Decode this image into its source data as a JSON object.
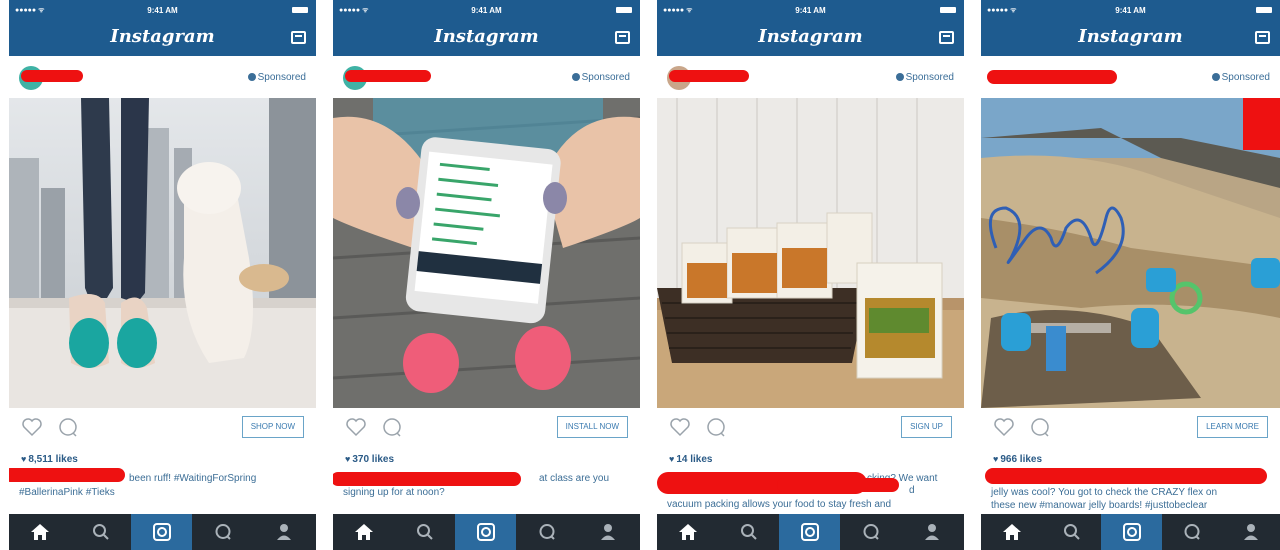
{
  "status_bar": {
    "signal": "●●●●● ᯤ",
    "time": "9:41 AM"
  },
  "app": {
    "title": "Instagram"
  },
  "posts": [
    {
      "sponsored": "Sponsored",
      "cta": "SHOP NOW",
      "likes": "8,511 likes",
      "caption": [
        "been ruff! #WaitingForSpring",
        "#BallerinaPink #Tieks"
      ]
    },
    {
      "sponsored": "Sponsored",
      "cta": "INSTALL NOW",
      "likes": "370 likes",
      "caption": [
        "at class are you",
        "signing up for at noon?"
      ]
    },
    {
      "sponsored": "Sponsored",
      "cta": "SIGN UP",
      "likes": "14 likes",
      "caption": [
        "cking? We want",
        "d",
        "vacuum packing allows your food to stay fresh and"
      ]
    },
    {
      "sponsored": "Sponsored",
      "cta": "LEARN MORE",
      "likes": "966 likes",
      "caption": [
        "jelly was cool? You got to check the CRAZY flex on",
        "these new #manowar jelly boards! #justtobeclear"
      ]
    }
  ],
  "colors": {
    "brand": "#1e5b8f",
    "tabbar": "#222a32",
    "redaction": "#ee1111"
  },
  "icons": [
    "home-icon",
    "search-icon",
    "camera-icon",
    "activity-icon",
    "profile-icon",
    "heart-icon",
    "comment-icon",
    "inbox-icon"
  ]
}
